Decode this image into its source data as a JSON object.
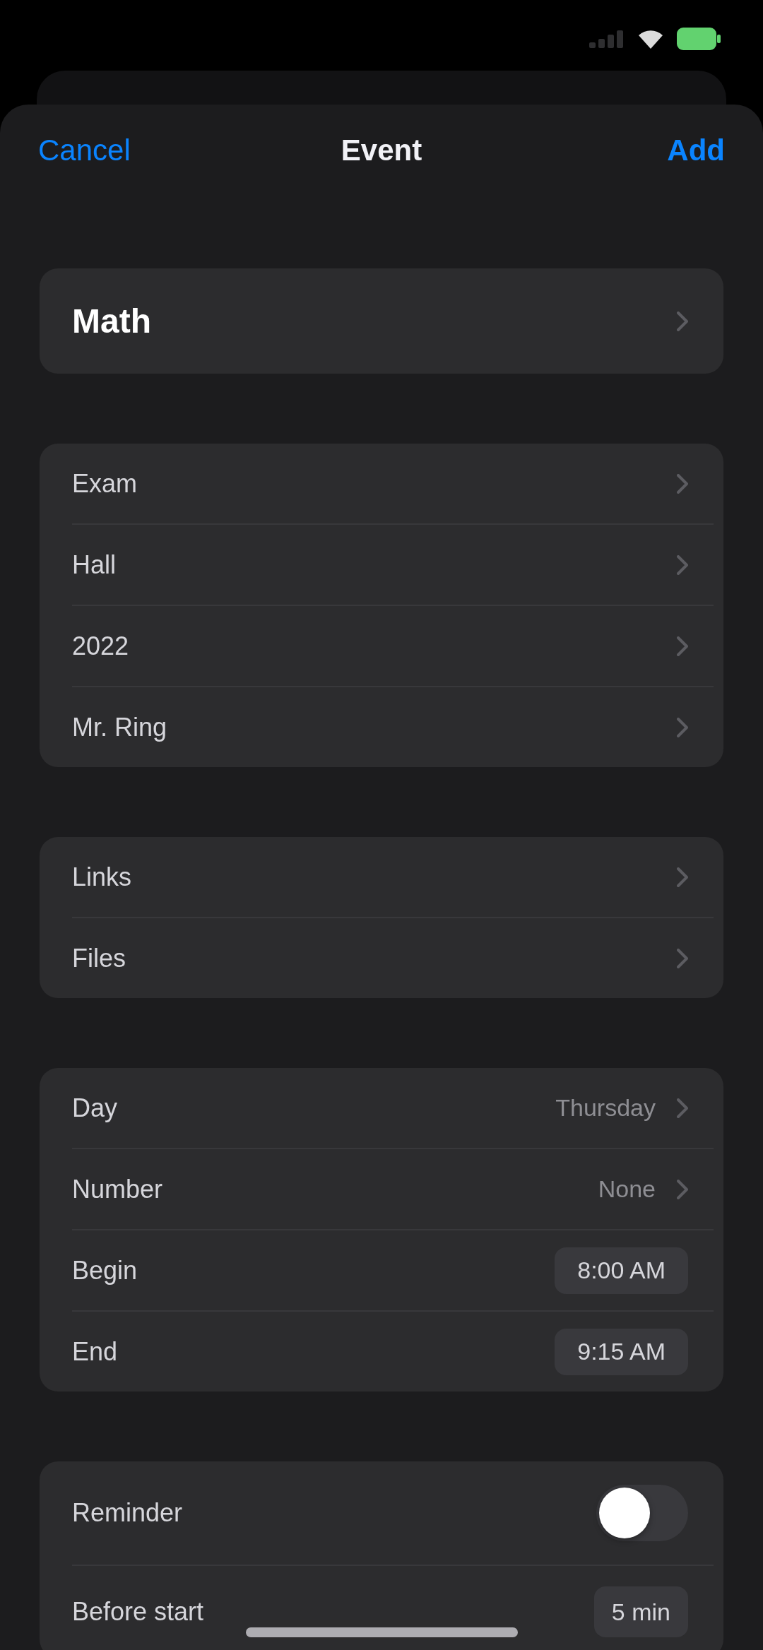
{
  "nav": {
    "cancel": "Cancel",
    "title": "Event",
    "add": "Add"
  },
  "groups": [
    {
      "rows": [
        {
          "kind": "title",
          "label": "Math"
        }
      ]
    },
    {
      "rows": [
        {
          "kind": "link",
          "label": "Exam"
        },
        {
          "kind": "link",
          "label": "Hall"
        },
        {
          "kind": "link",
          "label": "2022"
        },
        {
          "kind": "link",
          "label": "Mr. Ring"
        }
      ]
    },
    {
      "rows": [
        {
          "kind": "link",
          "label": "Links"
        },
        {
          "kind": "link",
          "label": "Files"
        }
      ]
    },
    {
      "rows": [
        {
          "kind": "picker",
          "label": "Day",
          "value": "Thursday"
        },
        {
          "kind": "picker",
          "label": "Number",
          "value": "None"
        },
        {
          "kind": "time",
          "label": "Begin",
          "value": "8:00 AM"
        },
        {
          "kind": "time",
          "label": "End",
          "value": "9:15 AM"
        }
      ]
    },
    {
      "rows": [
        {
          "kind": "toggle",
          "label": "Reminder",
          "on": false
        },
        {
          "kind": "stepper",
          "label": "Before start",
          "value": "5 min"
        }
      ]
    }
  ]
}
